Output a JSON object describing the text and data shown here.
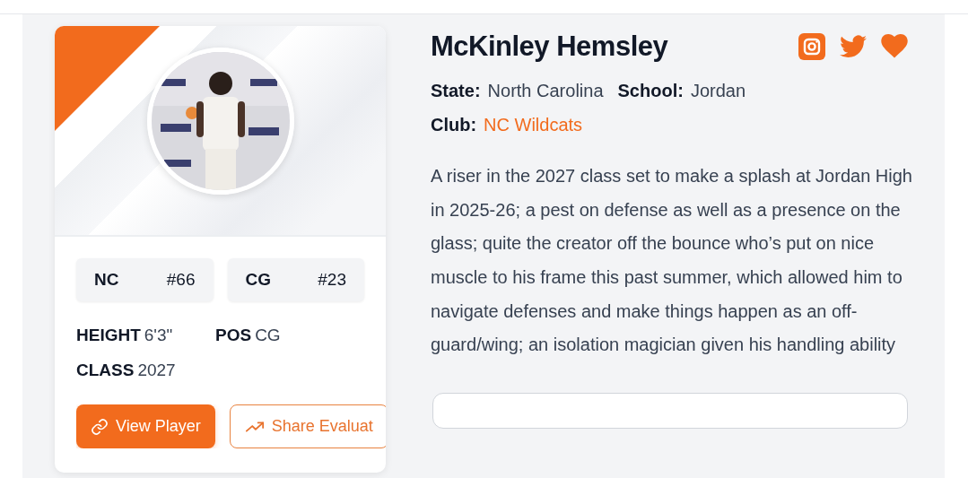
{
  "player": {
    "name": "McKinley Hemsley"
  },
  "social": [
    {
      "kind": "instagram"
    },
    {
      "kind": "twitter"
    },
    {
      "kind": "heart"
    }
  ],
  "info": [
    {
      "label": "State:",
      "value": "North Carolina",
      "kind": "text"
    },
    {
      "label": "School:",
      "value": "Jordan",
      "kind": "text"
    },
    {
      "label": "Club:",
      "value": "NC Wildcats",
      "kind": "link"
    }
  ],
  "description": "A riser in the 2027 class set to make a splash at Jordan High in 2025-26; a pest on defense as well as a presence on the glass; quite the creator off the bounce who’s put on nice muscle to his frame this past summer, which allowed him to navigate defenses and make things happen as an off-guard/wing; an isolation magician given his handling ability",
  "rankings": [
    {
      "label": "NC",
      "rank": "#66"
    },
    {
      "label": "CG",
      "rank": "#23"
    }
  ],
  "attributes": [
    {
      "label": "HEIGHT",
      "value": "6'3\""
    },
    {
      "label": "POS",
      "value": "CG"
    },
    {
      "label": "CLASS",
      "value": "2027"
    }
  ],
  "buttons": [
    {
      "label": "View Player",
      "kind": "primary"
    },
    {
      "label": "Share Evaluat",
      "kind": "outline"
    }
  ]
}
